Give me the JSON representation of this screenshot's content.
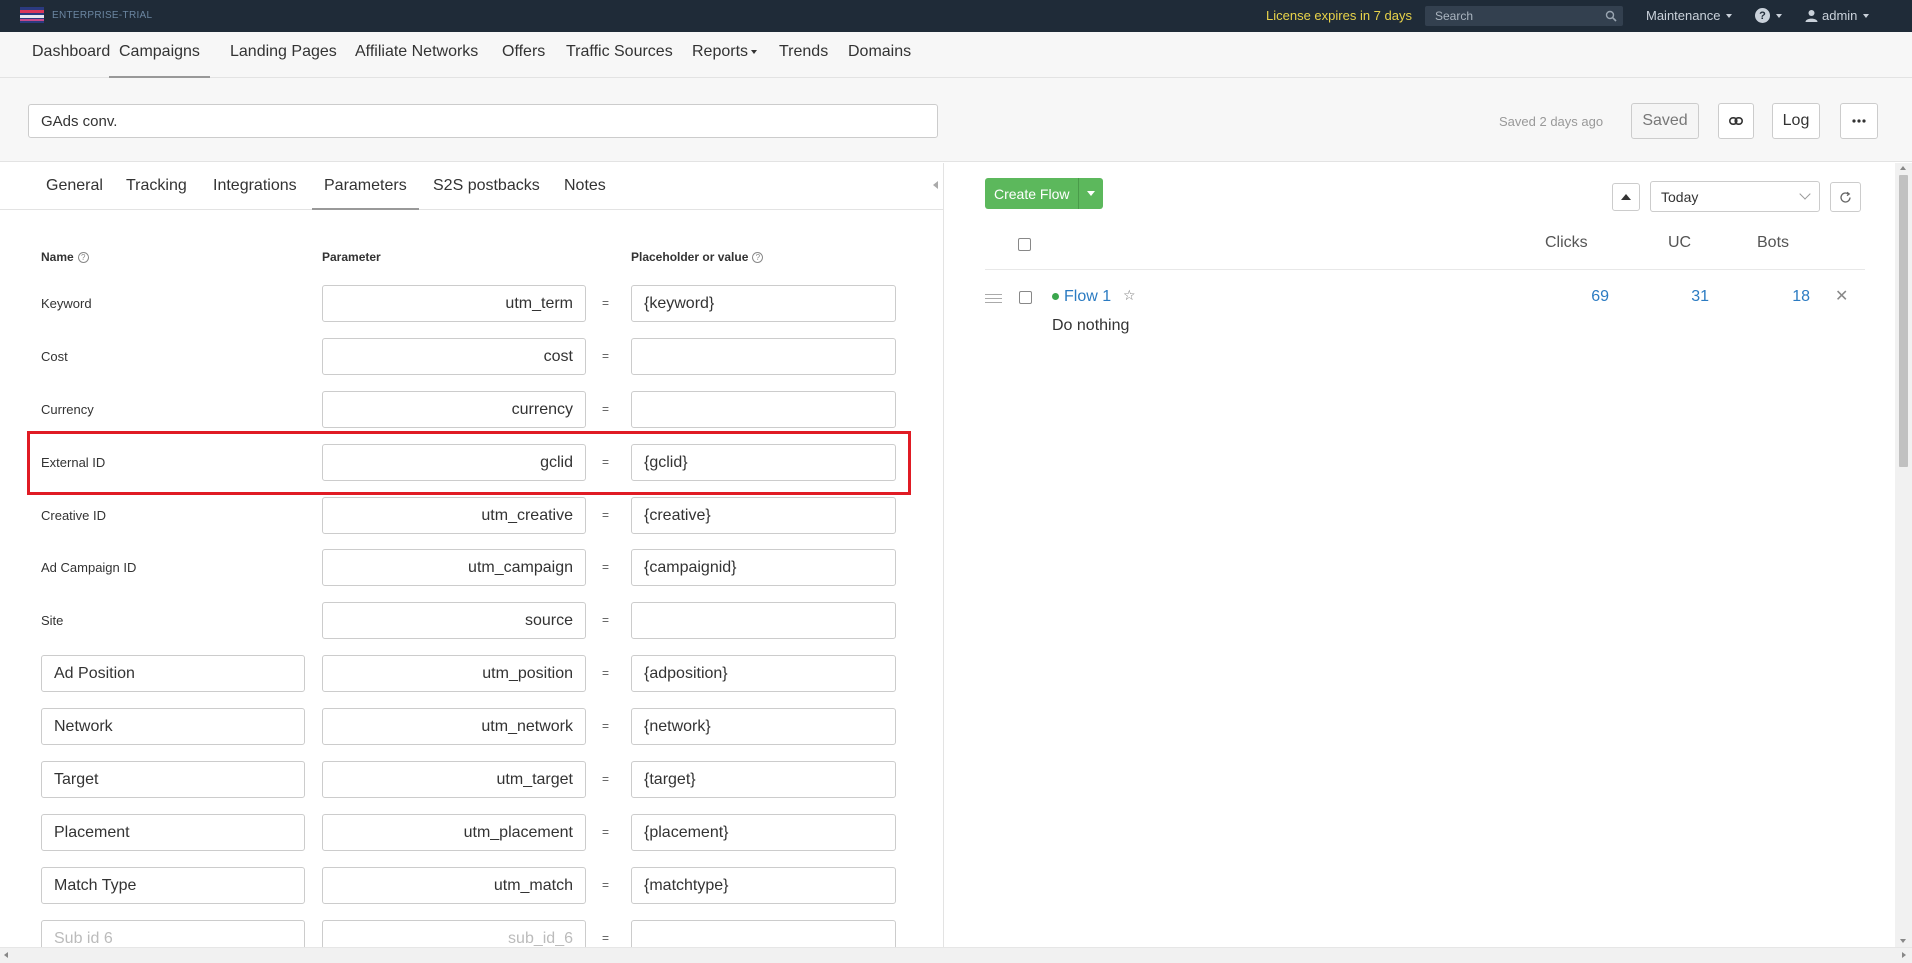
{
  "topbar": {
    "brand": "ENTERPRISE-TRIAL",
    "license": "License expires in 7 days",
    "search_placeholder": "Search",
    "maintenance": "Maintenance",
    "help": "?",
    "user": "admin"
  },
  "nav": {
    "items": [
      "Dashboard",
      "Campaigns",
      "Landing Pages",
      "Affiliate Networks",
      "Offers",
      "Traffic Sources",
      "Reports",
      "Trends",
      "Domains"
    ],
    "active": "Campaigns"
  },
  "campaign": {
    "name": "GAds conv.",
    "saved_status": "Saved 2 days ago",
    "saved_button": "Saved",
    "log_button": "Log",
    "more_button": "···"
  },
  "tabs": {
    "items": [
      "General",
      "Tracking",
      "Integrations",
      "Parameters",
      "S2S postbacks",
      "Notes"
    ],
    "active": "Parameters"
  },
  "parameters": {
    "headers": {
      "name": "Name",
      "parameter": "Parameter",
      "value": "Placeholder or value"
    },
    "rows": [
      {
        "name": "Keyword",
        "parameter": "utm_term",
        "value": "{keyword}",
        "editable_name": false
      },
      {
        "name": "Cost",
        "parameter": "cost",
        "value": "",
        "editable_name": false
      },
      {
        "name": "Currency",
        "parameter": "currency",
        "value": "",
        "editable_name": false
      },
      {
        "name": "External ID",
        "parameter": "gclid",
        "value": "{gclid}",
        "editable_name": false
      },
      {
        "name": "Creative ID",
        "parameter": "utm_creative",
        "value": "{creative}",
        "editable_name": false
      },
      {
        "name": "Ad Campaign ID",
        "parameter": "utm_campaign",
        "value": "{campaignid}",
        "editable_name": false
      },
      {
        "name": "Site",
        "parameter": "source",
        "value": "",
        "editable_name": false
      },
      {
        "name": "Ad Position",
        "parameter": "utm_position",
        "value": "{adposition}",
        "editable_name": true
      },
      {
        "name": "Network",
        "parameter": "utm_network",
        "value": "{network}",
        "editable_name": true
      },
      {
        "name": "Target",
        "parameter": "utm_target",
        "value": "{target}",
        "editable_name": true
      },
      {
        "name": "Placement",
        "parameter": "utm_placement",
        "value": "{placement}",
        "editable_name": true
      },
      {
        "name": "Match Type",
        "parameter": "utm_match",
        "value": "{matchtype}",
        "editable_name": true
      },
      {
        "name": "Sub id 6",
        "parameter": "sub_id_6",
        "value": "",
        "editable_name": true,
        "placeholder": true
      }
    ],
    "equals": "="
  },
  "flows": {
    "create_button": "Create Flow",
    "date_range": "Today",
    "columns": [
      "Clicks",
      "UC",
      "Bots"
    ],
    "rows": [
      {
        "name": "Flow 1",
        "action": "Do nothing",
        "clicks": "69",
        "uc": "31",
        "bots": "18"
      }
    ]
  },
  "colors": {
    "topbar_bg": "#1f2b38",
    "license_yellow": "#e8d34a",
    "create_flow_green": "#5cb85c",
    "link_blue": "#2b7bc2",
    "highlight_red": "#e01b24"
  }
}
